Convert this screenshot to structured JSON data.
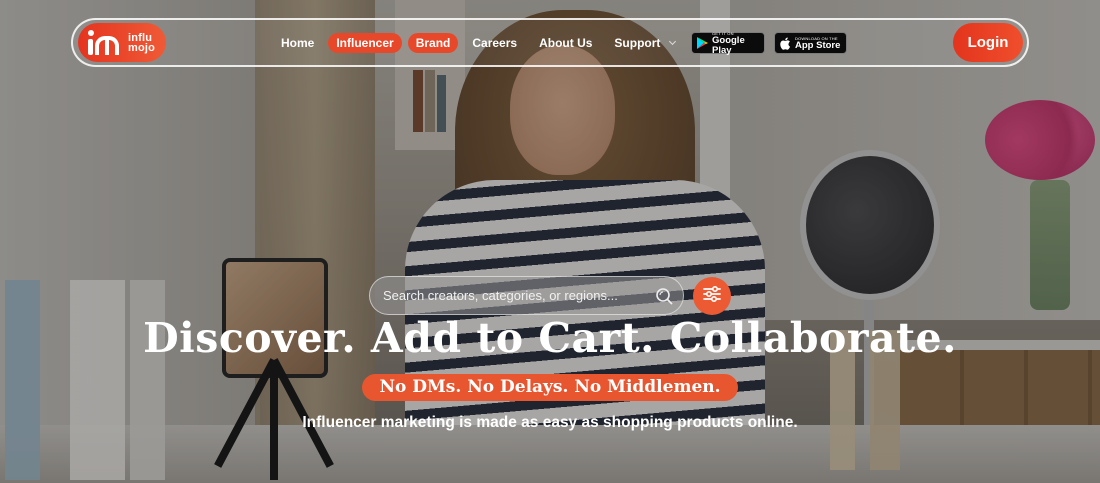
{
  "brand": {
    "logo_line1": "influ",
    "logo_line2": "mojo"
  },
  "nav": {
    "items": [
      {
        "label": "Home",
        "active": false
      },
      {
        "label": "Influencer",
        "active": true
      },
      {
        "label": "Brand",
        "active": true
      },
      {
        "label": "Careers",
        "active": false
      },
      {
        "label": "About Us",
        "active": false
      },
      {
        "label": "Support",
        "active": false
      }
    ],
    "google_play": {
      "small": "GET IT ON",
      "big": "Google Play"
    },
    "app_store": {
      "small": "Download on the",
      "big": "App Store"
    },
    "login_label": "Login"
  },
  "search": {
    "placeholder": "Search creators, categories, or regions...",
    "value": ""
  },
  "hero": {
    "headline": "Discover. Add to Cart. Collaborate.",
    "tagline": "No DMs. No Delays. No Middlemen.",
    "subline": "Influencer marketing is made as easy as shopping products online."
  },
  "colors": {
    "accent": "#e8482a",
    "accent_light": "#ec5a34"
  },
  "icons": [
    "search-icon",
    "filter-sliders-icon",
    "chevron-down-icon",
    "google-play-icon",
    "apple-icon"
  ]
}
